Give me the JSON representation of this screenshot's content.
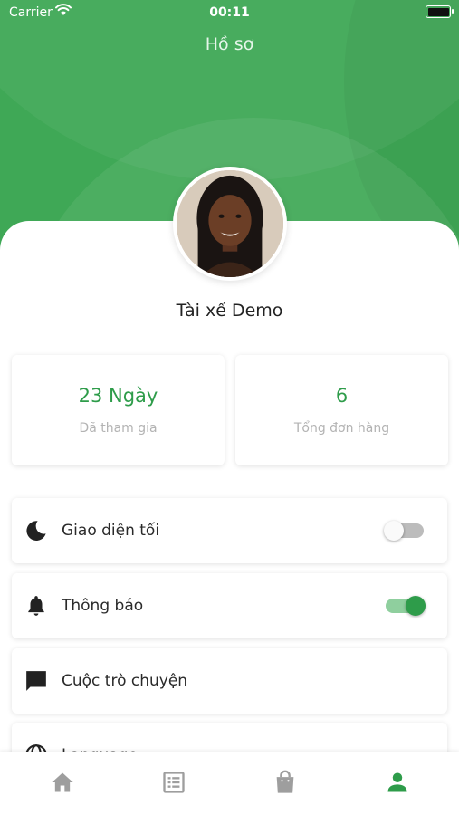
{
  "status_bar": {
    "carrier": "Carrier",
    "time": "00:11"
  },
  "header": {
    "title": "Hồ sơ"
  },
  "profile": {
    "name": "Tài xế Demo"
  },
  "stats": [
    {
      "value": "23 Ngày",
      "label": "Đã tham gia"
    },
    {
      "value": "6",
      "label": "Tổng đơn hàng"
    }
  ],
  "settings": [
    {
      "label": "Giao diện tối",
      "icon": "moon-icon",
      "toggle": false
    },
    {
      "label": "Thông báo",
      "icon": "bell-icon",
      "toggle": true
    },
    {
      "label": "Cuộc trò chuyện",
      "icon": "chat-icon"
    },
    {
      "label": "Language",
      "icon": "globe-icon"
    }
  ],
  "bottom_nav": [
    {
      "icon": "home-icon",
      "active": false
    },
    {
      "icon": "orders-list-icon",
      "active": false
    },
    {
      "icon": "shopping-bag-icon",
      "active": false
    },
    {
      "icon": "profile-icon",
      "active": true
    }
  ],
  "colors": {
    "brand_green": "#3fa856",
    "accent_green": "#2e9c4a",
    "nav_inactive": "#9e9e9e"
  }
}
